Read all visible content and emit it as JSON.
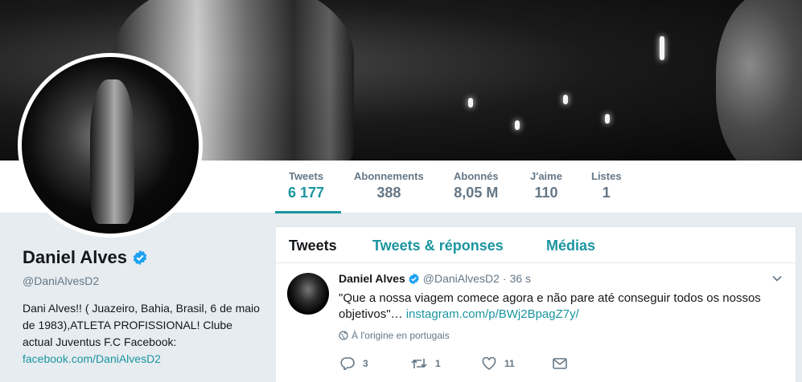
{
  "profile": {
    "name": "Daniel Alves",
    "handle": "@DaniAlvesD2",
    "bio_line1": "Dani Alves!! ( Juazeiro, Bahia, Brasil, 6 de maio de 1983),ATLETA PROFISSIONAL! Clube actual Juventus F.C Facebook:",
    "bio_link": "facebook.com/DaniAlvesD2"
  },
  "stats": [
    {
      "label": "Tweets",
      "value": "6 177",
      "active": true
    },
    {
      "label": "Abonnements",
      "value": "388"
    },
    {
      "label": "Abonnés",
      "value": "8,05 M"
    },
    {
      "label": "J'aime",
      "value": "110"
    },
    {
      "label": "Listes",
      "value": "1"
    }
  ],
  "tabs": [
    {
      "label": "Tweets",
      "active": true
    },
    {
      "label": "Tweets & réponses"
    },
    {
      "label": "Médias"
    }
  ],
  "tweet": {
    "name": "Daniel Alves",
    "handle": "@DaniAlvesD2",
    "separator": "·",
    "time": "36 s",
    "text": "\"Que a nossa viagem comece agora e não pare até conseguir todos os nossos objetivos\"…",
    "link": "instagram.com/p/BWj2BpagZ7y/",
    "translate": "À l'origine en portugais",
    "replies": "3",
    "retweets": "1",
    "likes": "11"
  },
  "colors": {
    "accent": "#1b95a0",
    "verified": "#1da1f2",
    "muted": "#657786"
  },
  "icons": [
    "verified-icon",
    "caret-down-icon",
    "globe-icon",
    "reply-icon",
    "retweet-icon",
    "like-icon",
    "message-icon"
  ]
}
